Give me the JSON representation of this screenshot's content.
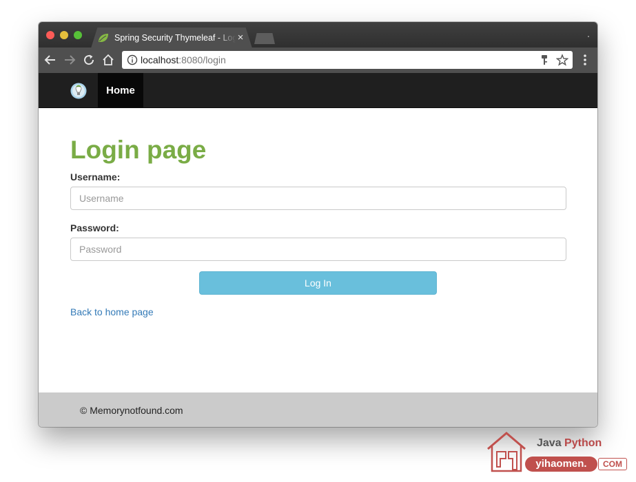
{
  "browser": {
    "tab": {
      "title": "Spring Security Thymeleaf - Login",
      "close_glyph": "×",
      "favicon": "spring-leaf-icon"
    },
    "toolbar": {
      "back_icon": "arrow-left-icon",
      "forward_icon": "arrow-right-icon",
      "reload_icon": "reload-icon",
      "home_icon": "home-icon",
      "url_host": "localhost",
      "url_rest": ":8080/login",
      "info_icon": "info-icon",
      "key_icon": "key-icon",
      "star_icon": "star-icon",
      "menu_icon": "vertical-dots-icon"
    }
  },
  "navbar": {
    "logo_icon": "app-logo-icon",
    "home_label": "Home"
  },
  "page": {
    "heading": "Login page",
    "username_label": "Username:",
    "username_placeholder": "Username",
    "password_label": "Password:",
    "password_placeholder": "Password",
    "login_button": "Log In",
    "back_link": "Back to home page"
  },
  "footer": {
    "text": "© Memorynotfound.com"
  },
  "watermark": {
    "java": "Java",
    "python": "Python",
    "site": "yihaomen.",
    "tld": "COM"
  },
  "colors": {
    "heading": "#7aac46",
    "navbar": "#1f1f1f",
    "login_button": "#69bfdc",
    "link": "#337ab7",
    "footer": "#cbcbcb"
  }
}
